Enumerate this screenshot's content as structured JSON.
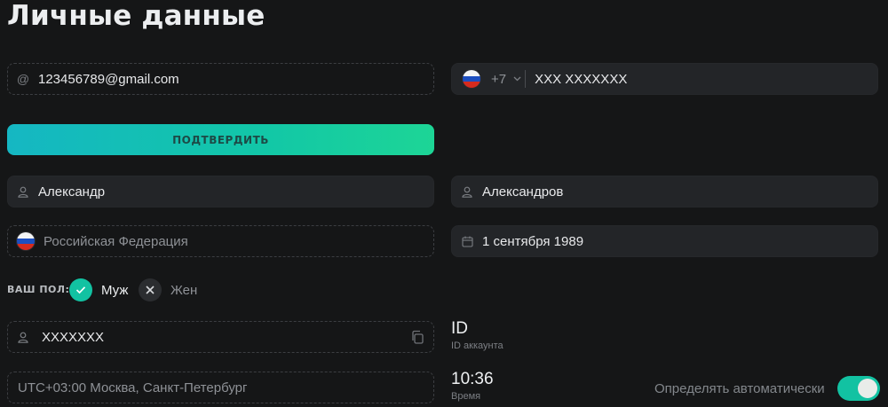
{
  "page": {
    "title": "Личные данные"
  },
  "email": {
    "value": "123456789@gmail.com",
    "icon": "at-icon"
  },
  "phone": {
    "country_code": "+7",
    "value": "XXX XXXXXXX",
    "flag": "russia-flag-icon"
  },
  "confirm_button": {
    "label": "ПОДТВЕРДИТЬ"
  },
  "first_name": {
    "value": "Александр",
    "icon": "user-icon"
  },
  "last_name": {
    "value": "Александров",
    "icon": "user-icon"
  },
  "country": {
    "placeholder": "Российская Федерация",
    "flag": "russia-flag-icon"
  },
  "birth_date": {
    "value": "1 сентября 1989",
    "icon": "calendar-icon"
  },
  "gender": {
    "label": "ВАШ ПОЛ:",
    "options": [
      {
        "label": "Муж",
        "selected": true,
        "icon": "check-icon"
      },
      {
        "label": "Жен",
        "selected": false,
        "icon": "close-icon"
      }
    ]
  },
  "account": {
    "value": "XXXXXXX",
    "icon": "user-icon",
    "copy_icon": "copy-icon"
  },
  "account_id": {
    "value": "ID",
    "caption": "ID аккаунта"
  },
  "timezone": {
    "value": "UTC+03:00 Москва, Санкт-Петербург"
  },
  "time": {
    "value": "10:36",
    "caption": "Время"
  },
  "auto_detect": {
    "label": "Определять автоматически",
    "enabled": true
  },
  "colors": {
    "accent": "#12c2a2",
    "background": "#151617",
    "field": "#232528"
  }
}
